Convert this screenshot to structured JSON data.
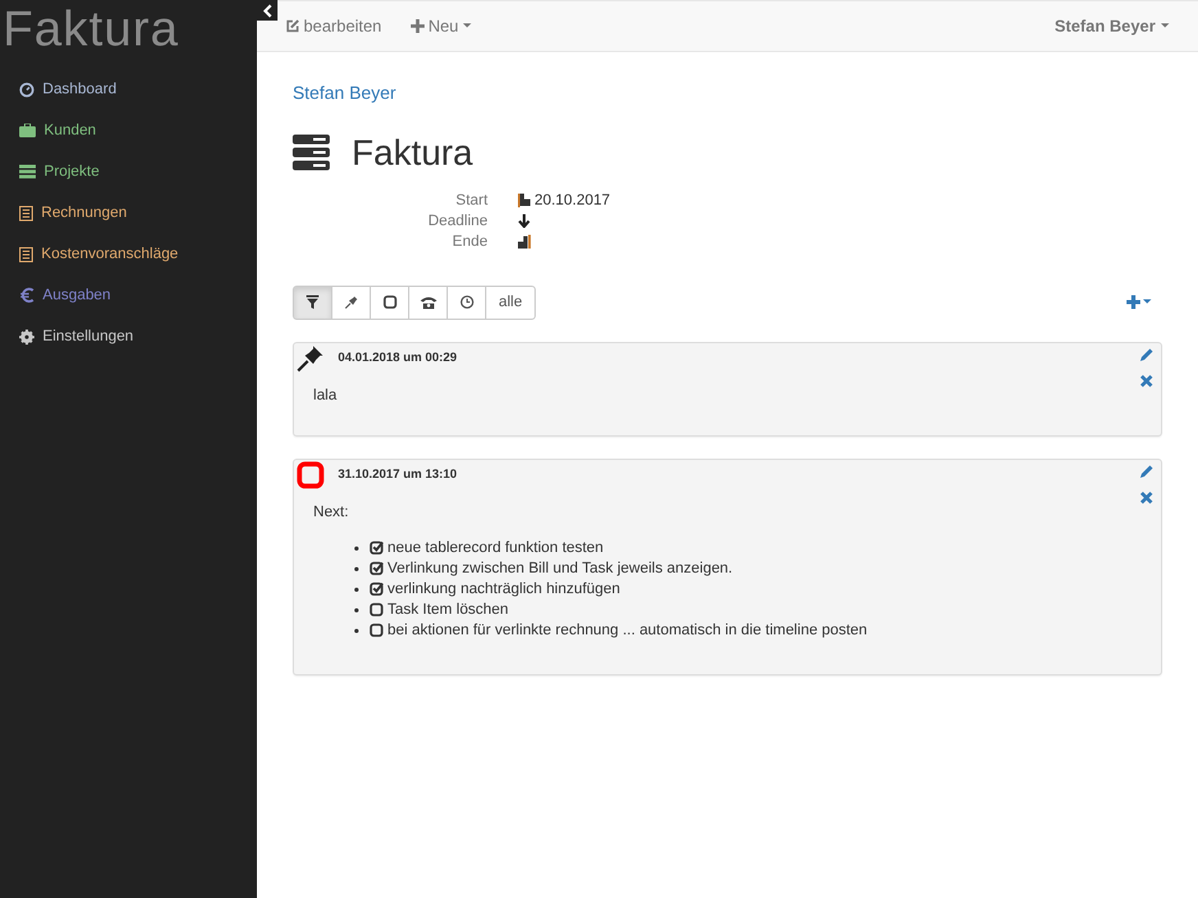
{
  "sidebar": {
    "logo": "Faktura",
    "items": [
      {
        "label": "Dashboard",
        "color": "#a9b8d4"
      },
      {
        "label": "Kunden",
        "color": "#7fbf7f"
      },
      {
        "label": "Projekte",
        "color": "#7fbf7f"
      },
      {
        "label": "Rechnungen",
        "color": "#e0a96d"
      },
      {
        "label": "Kostenvoranschläge",
        "color": "#e0a96d"
      },
      {
        "label": "Ausgaben",
        "color": "#7f82c9"
      },
      {
        "label": "Einstellungen",
        "color": "#c8c8c8"
      }
    ]
  },
  "toolbar": {
    "edit": "bearbeiten",
    "new": "Neu",
    "user": "Stefan Beyer"
  },
  "breadcrumb": "Stefan Beyer",
  "title": "Faktura",
  "dates": [
    {
      "label": "Start",
      "value": "20.10.2017"
    },
    {
      "label": "Deadline"
    },
    {
      "label": "Ende"
    }
  ],
  "filters": [
    {
      "selected": true
    },
    {
      "selected": false
    },
    {
      "selected": false
    },
    {
      "selected": false
    },
    {
      "selected": false
    },
    {
      "label": "alle",
      "selected": false
    }
  ],
  "entries": [
    {
      "kind": "pinned",
      "time": "04.01.2018 um 00:29",
      "text": "lala"
    },
    {
      "kind": "task",
      "time": "31.10.2017 um 13:10",
      "text": "Next:",
      "items": [
        {
          "text": "neue tablerecord funktion testen",
          "checked": true
        },
        {
          "text": "Verlinkung zwischen Bill und Task jeweils anzeigen.",
          "checked": true
        },
        {
          "text": "verlinkung nachträglich hinzufügen",
          "checked": true
        },
        {
          "text": "Task Item löschen",
          "checked": false
        },
        {
          "text": "bei aktionen für verlinkte rechnung ... automatisch in die timeline posten",
          "checked": false
        }
      ]
    }
  ]
}
